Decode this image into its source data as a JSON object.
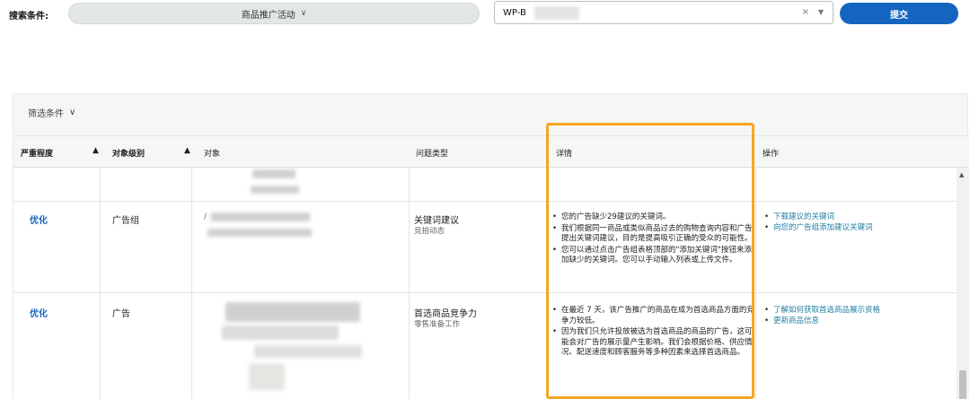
{
  "search": {
    "label": "搜索条件:",
    "campaign_select": "商品推广活动",
    "asin_value": "WP-B",
    "clear_glyph": "×",
    "dropdown_glyph": "▼",
    "submit_label": "提交"
  },
  "filter": {
    "label": "筛选条件",
    "chevron": "∨"
  },
  "columns": {
    "severity": "严重程度",
    "level": "对象级别",
    "object": "对象",
    "issue_type": "问题类型",
    "details": "详情",
    "actions": "操作"
  },
  "rows": [
    {
      "severity": "优化",
      "level": "广告组",
      "object_prefix": "/",
      "issue_type": "关键词建议",
      "issue_sub": "竞拍动态",
      "details": [
        "您的广告缺少29建议的关键词。",
        "我们根据同一商品或类似商品过去的购物查询内容和广告提出关键词建议，目的是提高吸引正确的受众的可能性。",
        "您可以通过点击广告组表格顶部的\"添加关键词\"按钮来添加缺少的关键词。您可以手动输入列表或上传文件。"
      ],
      "actions": [
        "下载建议的关键词",
        "向您的广告组添加建议关键词"
      ]
    },
    {
      "severity": "优化",
      "level": "广告",
      "issue_type": "首选商品竞争力",
      "issue_sub": "零售准备工作",
      "details": [
        "在最近 7 天，该广告推广的商品在成为首选商品方面的竞争力较低。",
        "因为我们只允许投放被选为首选商品的商品的广告，这可能会对广告的展示量产生影响。我们会根据价格、供应情况、配送速度和顾客服务等多种因素来选择首选商品。"
      ],
      "actions": [
        "了解如何获取首选商品展示资格",
        "更新商品信息"
      ]
    }
  ],
  "colors": {
    "accent": "#1565c0",
    "highlight": "#f5a623",
    "link": "#1f7ea0"
  }
}
